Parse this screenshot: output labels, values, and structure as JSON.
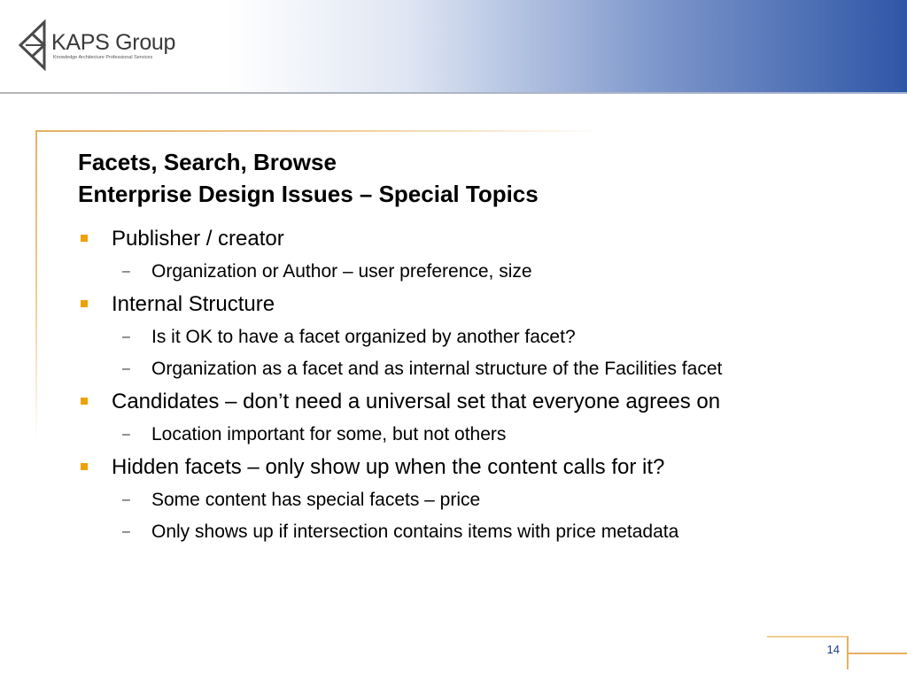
{
  "brand": {
    "name": "KAPS Group",
    "tagline": "Knowledge Architecture Professional Services"
  },
  "slide": {
    "title_line1": "Facets, Search, Browse",
    "title_line2": "Enterprise Design Issues – Special Topics",
    "page_number": "14"
  },
  "bullets": [
    {
      "text": "Publisher / creator",
      "subs": [
        "Organization or Author – user preference, size"
      ]
    },
    {
      "text": "Internal Structure",
      "subs": [
        "Is it OK to have a facet organized by another facet?",
        "Organization as a facet and as internal structure of the Facilities facet"
      ]
    },
    {
      "text": "Candidates – don’t need a universal set that everyone agrees on",
      "subs": [
        "Location important for some, but not others"
      ]
    },
    {
      "text": "Hidden facets – only show up when the content calls for it?",
      "subs": [
        "Some content has special facets – price",
        "Only shows up if intersection contains items with price metadata"
      ]
    }
  ],
  "colors": {
    "bullet": "#f0a000",
    "frame": "#e6b060",
    "header_blue": "#2f56a6",
    "page_number": "#1a3a8c"
  },
  "icons": {
    "logo_mark": "kaps-logo-icon",
    "bullet": "square-bullet-icon",
    "sub_bullet": "dash-icon"
  }
}
